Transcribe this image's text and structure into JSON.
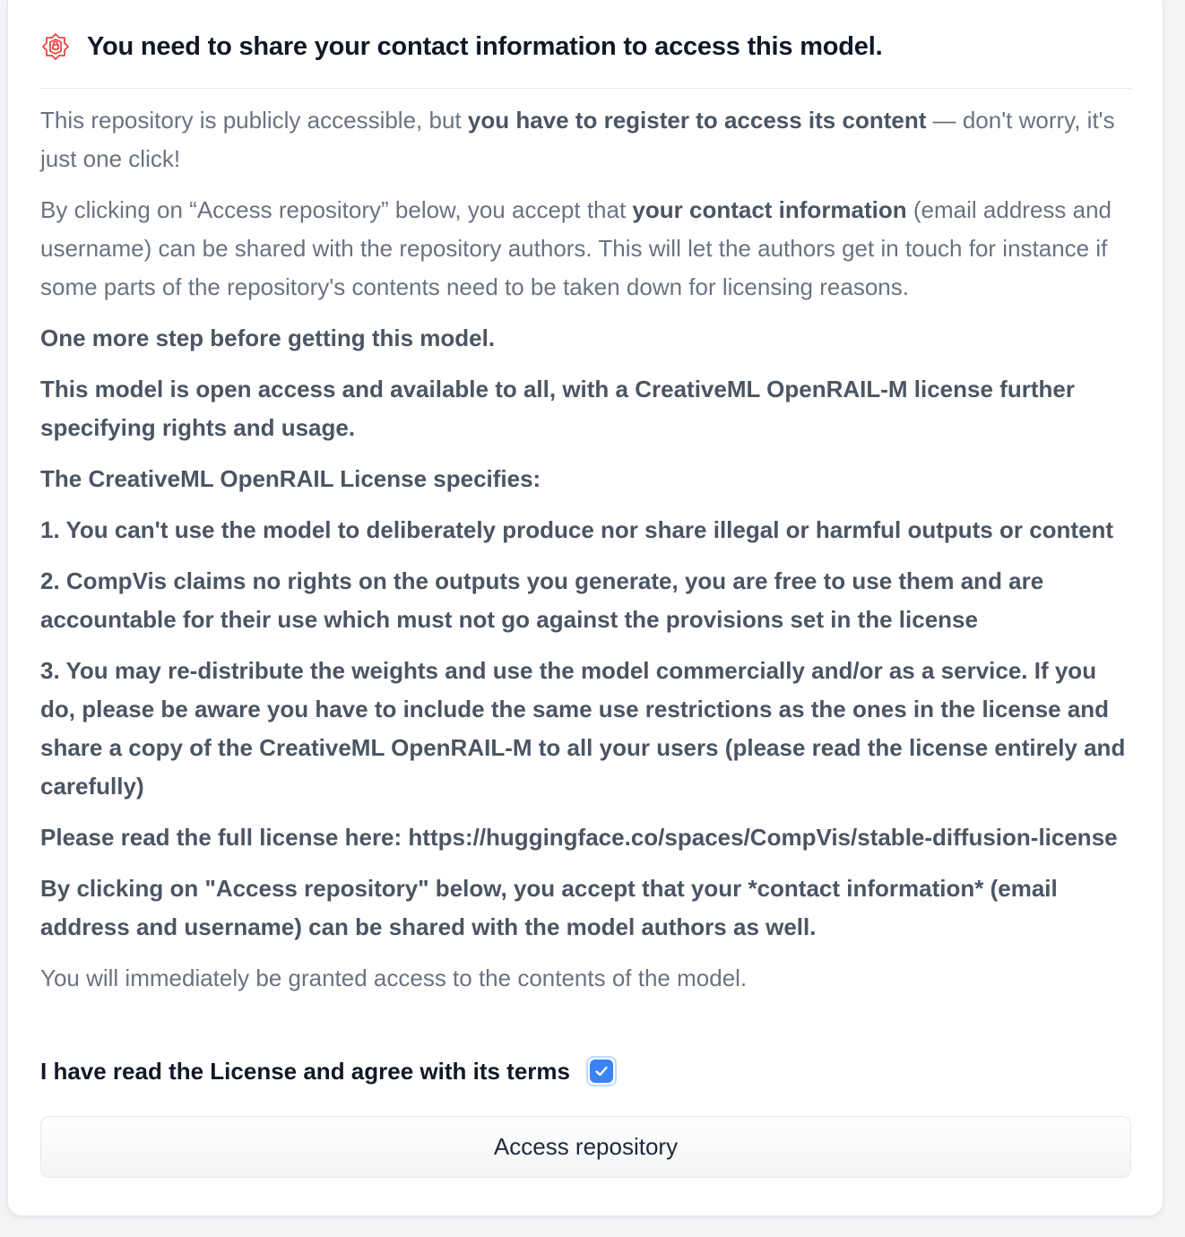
{
  "gate": {
    "title": "You need to share your contact information to access this model.",
    "icon": "gated-lock-icon",
    "accent_color": "#ef4444",
    "intro": {
      "before": "This repository is publicly accessible, but ",
      "bold": "you have to register to access its content",
      "after": " — don't worry, it's just one click!"
    },
    "consent": {
      "before": "By clicking on “Access repository” below, you accept that ",
      "bold": "your contact information",
      "after": " (email address and username) can be shared with the repository authors. This will let the authors get in touch for instance if some parts of the repository's contents need to be taken down for licensing reasons."
    },
    "prompt_paragraphs": [
      "One more step before getting this model.",
      "This model is open access and available to all, with a CreativeML OpenRAIL-M license further specifying rights and usage.",
      "The CreativeML OpenRAIL License specifies:",
      "1. You can't use the model to deliberately produce nor share illegal or harmful outputs or content",
      "2. CompVis claims no rights on the outputs you generate, you are free to use them and are accountable for their use which must not go against the provisions set in the license",
      "3. You may re-distribute the weights and use the model commercially and/or as a service. If you do, please be aware you have to include the same use restrictions as the ones in the license and share a copy of the CreativeML OpenRAIL-M to all your users (please read the license entirely and carefully)",
      "Please read the full license here: https://huggingface.co/spaces/CompVis/stable-diffusion-license",
      "By clicking on \"Access repository\" below, you accept that your *contact information* (email address and username) can be shared with the model authors as well."
    ],
    "immediate_note": "You will immediately be granted access to the contents of the model.",
    "agree_label": "I have read the License and agree with its terms",
    "agree_checked": true,
    "checkbox_color": "#3b82f6",
    "access_button_label": "Access repository"
  }
}
